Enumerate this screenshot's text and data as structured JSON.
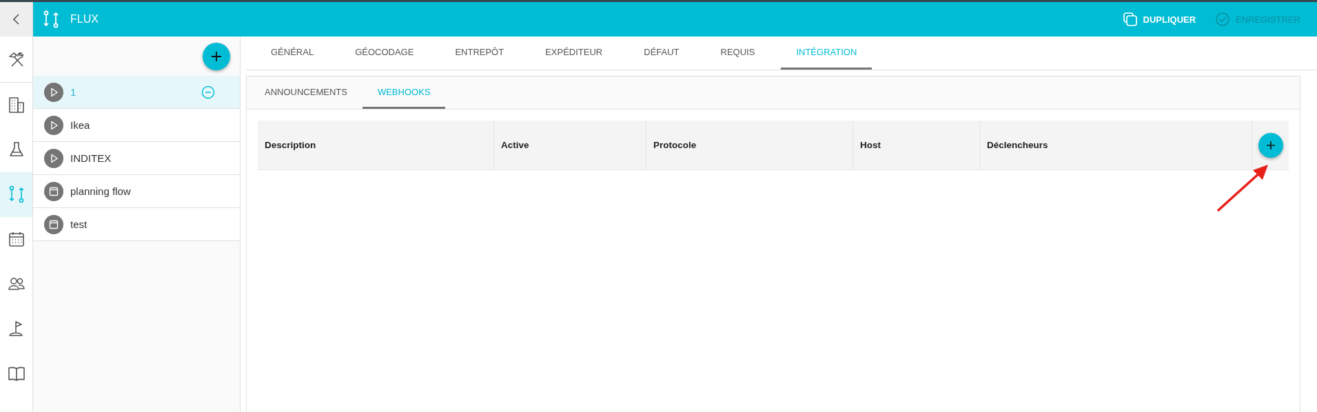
{
  "header": {
    "title": "FLUX",
    "actions": [
      {
        "label": "DUPLIQUER",
        "disabled": false
      },
      {
        "label": "ENREGISTRER",
        "disabled": true
      }
    ]
  },
  "rail": [
    {
      "selected": false
    },
    {
      "selected": false
    },
    {
      "selected": false
    },
    {
      "selected": true
    },
    {
      "selected": false
    },
    {
      "selected": false
    },
    {
      "selected": false
    },
    {
      "selected": false
    }
  ],
  "flows": [
    {
      "name": "1",
      "kind": "run",
      "selected": true
    },
    {
      "name": "Ikea",
      "kind": "run",
      "selected": false
    },
    {
      "name": "INDITEX",
      "kind": "run",
      "selected": false
    },
    {
      "name": "planning flow",
      "kind": "schedule",
      "selected": false
    },
    {
      "name": "test",
      "kind": "schedule",
      "selected": false
    }
  ],
  "tabs": [
    {
      "label": "GÉNÉRAL",
      "selected": false
    },
    {
      "label": "GÉOCODAGE",
      "selected": false
    },
    {
      "label": "ENTREPÔT",
      "selected": false
    },
    {
      "label": "EXPÉDITEUR",
      "selected": false
    },
    {
      "label": "DÉFAUT",
      "selected": false
    },
    {
      "label": "REQUIS",
      "selected": false
    },
    {
      "label": "INTÉGRATION",
      "selected": true
    }
  ],
  "subtabs": [
    {
      "label": "ANNOUNCEMENTS",
      "selected": false
    },
    {
      "label": "WEBHOOKS",
      "selected": true
    }
  ],
  "table": {
    "columns": [
      "Description",
      "Active",
      "Protocole",
      "Host",
      "Déclencheurs"
    ]
  }
}
